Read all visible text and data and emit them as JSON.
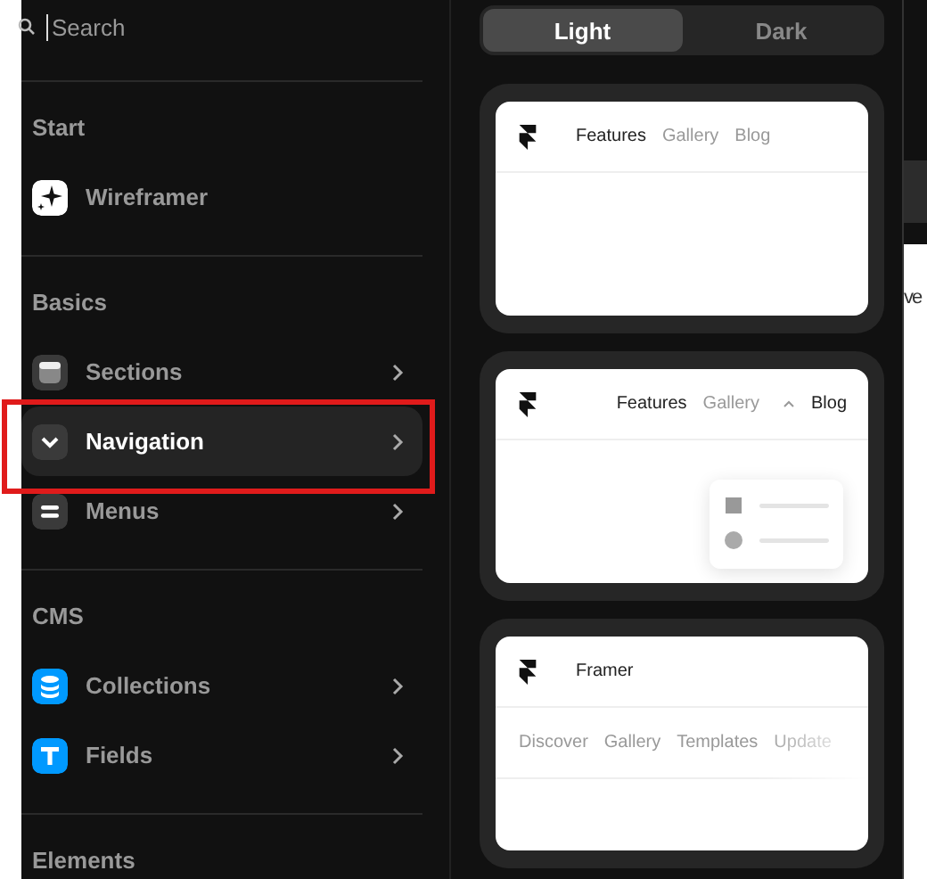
{
  "search": {
    "placeholder": "Search"
  },
  "sections": [
    {
      "title": "Start",
      "items": [
        {
          "label": "Wireframer",
          "kind": "sparkle",
          "submenu": false,
          "selected": false,
          "annotated": false
        }
      ]
    },
    {
      "title": "Basics",
      "items": [
        {
          "label": "Sections",
          "kind": "section",
          "submenu": true,
          "selected": false,
          "annotated": false
        },
        {
          "label": "Navigation",
          "kind": "nav",
          "submenu": true,
          "selected": true,
          "annotated": true
        },
        {
          "label": "Menus",
          "kind": "menu",
          "submenu": true,
          "selected": false,
          "annotated": false
        }
      ]
    },
    {
      "title": "CMS",
      "items": [
        {
          "label": "Collections",
          "kind": "collection",
          "submenu": true,
          "selected": false,
          "annotated": false
        },
        {
          "label": "Fields",
          "kind": "field",
          "submenu": true,
          "selected": false,
          "annotated": false
        }
      ]
    },
    {
      "title": "Elements"
    }
  ],
  "theme_tabs": [
    {
      "label": "Light",
      "selected": true
    },
    {
      "label": "Dark",
      "selected": false
    }
  ],
  "previews": [
    {
      "kind": "inline",
      "links": [
        {
          "label": "Features",
          "muted": false,
          "caret": false
        },
        {
          "label": "Gallery",
          "muted": true,
          "caret": false
        },
        {
          "label": "Blog",
          "muted": true,
          "caret": false
        }
      ]
    },
    {
      "kind": "dropdown",
      "links": [
        {
          "label": "Features",
          "muted": false,
          "caret": false
        },
        {
          "label": "Gallery",
          "muted": true,
          "caret": true
        },
        {
          "label": "Blog",
          "muted": false,
          "caret": false
        }
      ]
    },
    {
      "kind": "stacked",
      "brand": "Framer",
      "links": [
        {
          "label": "Discover",
          "muted": true,
          "caret": false
        },
        {
          "label": "Gallery",
          "muted": true,
          "caret": false
        },
        {
          "label": "Templates",
          "muted": true,
          "caret": false
        },
        {
          "label": "Update",
          "muted": true,
          "caret": false
        }
      ]
    }
  ],
  "edge_text": "ve"
}
